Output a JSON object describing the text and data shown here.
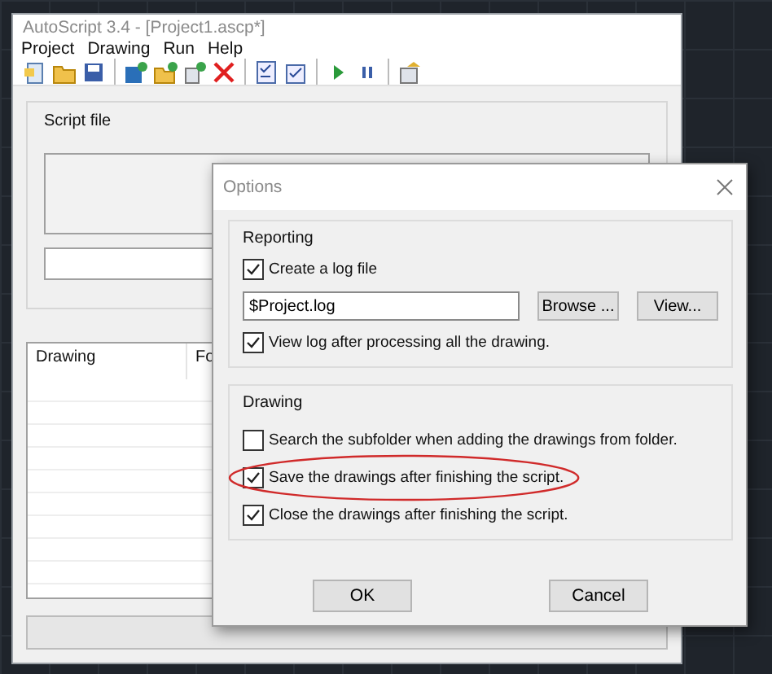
{
  "window": {
    "title": "AutoScript 3.4 - [Project1.ascp*]"
  },
  "menu": [
    "Project",
    "Drawing",
    "Run",
    "Help"
  ],
  "script_file": {
    "label": "Script file"
  },
  "table": {
    "columns": [
      "Drawing",
      "Fo"
    ]
  },
  "progress": {
    "level": 0
  },
  "dialog": {
    "title": "Options",
    "reporting": {
      "label": "Reporting",
      "create_log": {
        "label": "Create a log file",
        "checked": true
      },
      "log_file": {
        "value": "$Project.log"
      },
      "buttons": [
        "Browse ...",
        "View..."
      ],
      "view_log": {
        "label": "View log after processing all the drawing.",
        "checked": true
      }
    },
    "drawing": {
      "label": "Drawing",
      "options": [
        {
          "label": "Search the subfolder when adding the drawings from folder.",
          "checked": false,
          "circled": false
        },
        {
          "label": "Save the drawings after finishing the script.",
          "checked": true,
          "circled": true
        },
        {
          "label": "Close the drawings after finishing the script.",
          "checked": true,
          "circled": false
        }
      ]
    },
    "buttons": [
      "OK",
      "Cancel"
    ]
  }
}
